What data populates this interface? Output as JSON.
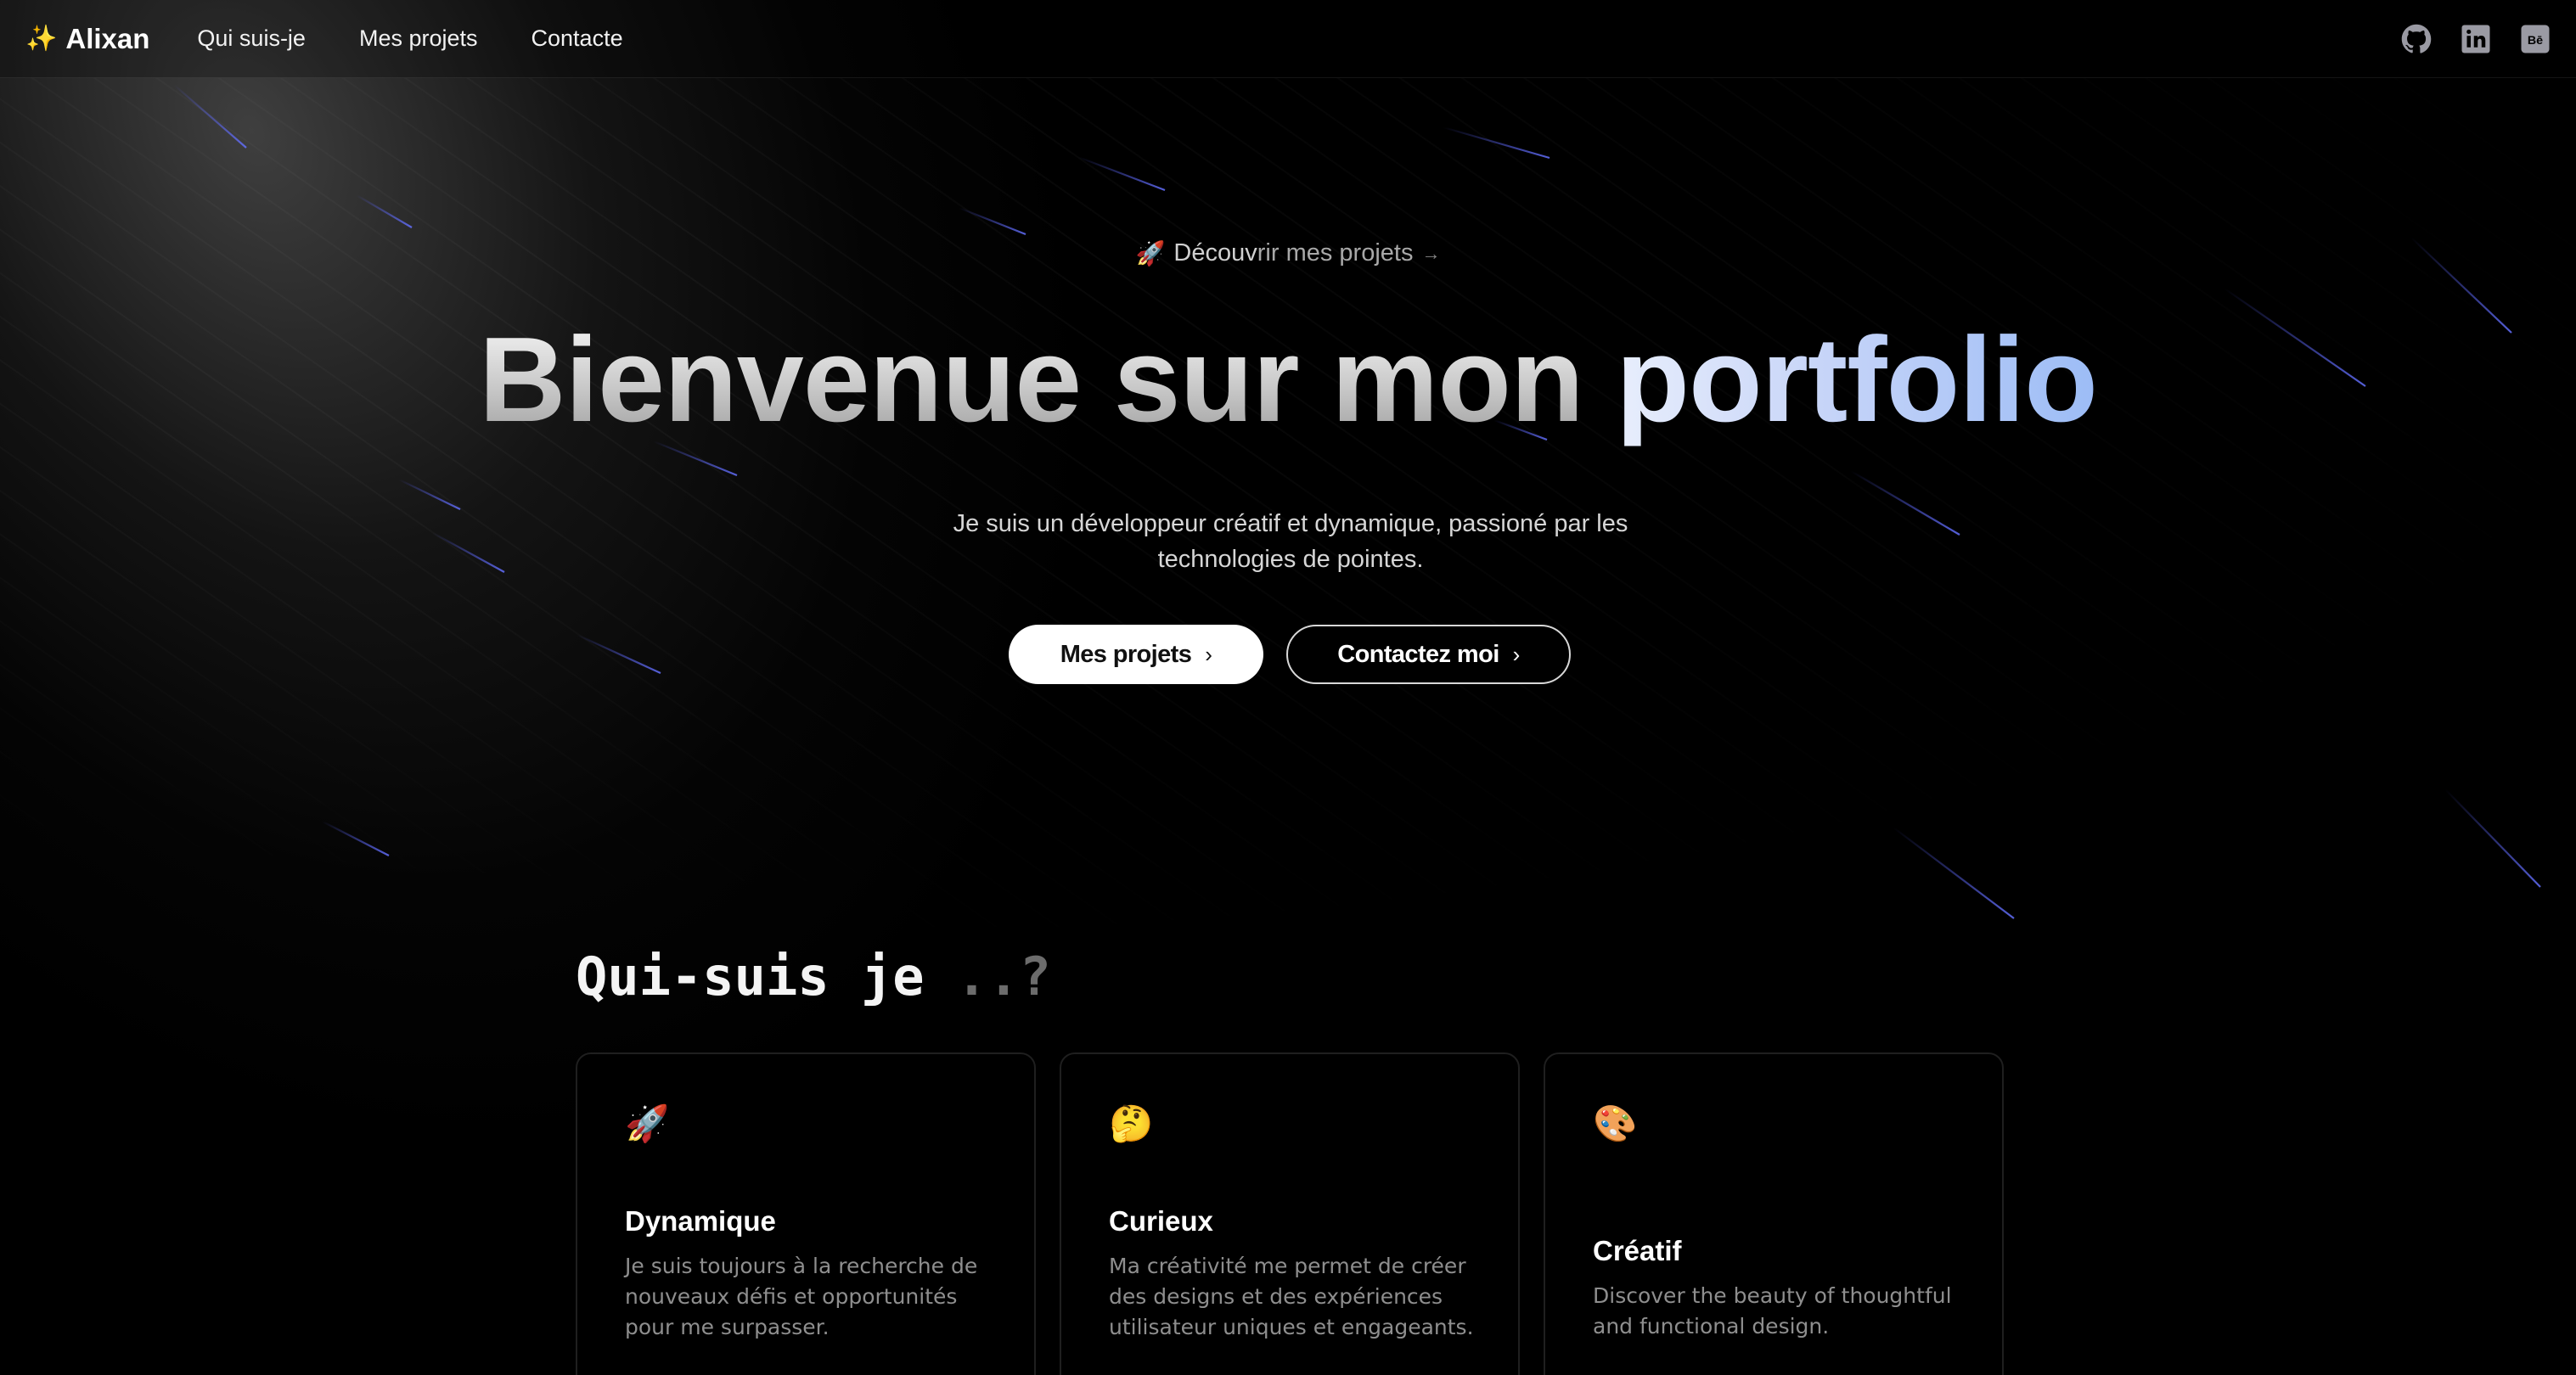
{
  "nav": {
    "brand_icon": "✨",
    "brand": "Alixan",
    "links": [
      "Qui suis-je",
      "Mes projets",
      "Contacte"
    ],
    "icons": [
      "github-icon",
      "linkedin-icon",
      "behance-icon"
    ],
    "behance_label": "Bē"
  },
  "hero": {
    "pill_icon": "🚀",
    "pill_text_a": "Découv",
    "pill_text_b": "rir mes projets",
    "pill_arrow": "→",
    "title_part1": "Bienvenue sur mon",
    "title_part2": "portfolio",
    "subtitle": "Je suis un développeur créatif et dynamique, passioné par les technologies de pointes.",
    "primary_button": "Mes projets",
    "secondary_button": "Contactez moi",
    "chevron": "›"
  },
  "about": {
    "title": "Qui-suis je",
    "title_suffix": " ..?",
    "cards": [
      {
        "emoji": "🚀",
        "title": "Dynamique",
        "text": "Je suis toujours à la recherche de nouveaux défis et opportunités pour me surpasser."
      },
      {
        "emoji": "🤔",
        "title": "Curieux",
        "text": "Ma créativité me permet de créer des designs et des expériences utilisateur uniques et engageants."
      },
      {
        "emoji": "🎨",
        "title": "Créatif",
        "text": "Discover the beauty of thoughtful and functional design."
      }
    ]
  },
  "colors": {
    "background": "#000000",
    "accent_blue": "#9cbcf6",
    "muted_text": "#8e8e8e"
  }
}
